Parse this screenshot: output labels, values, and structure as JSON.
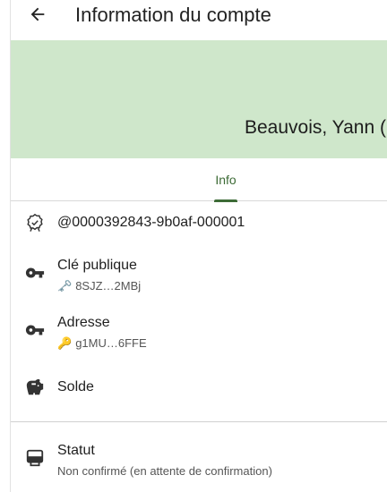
{
  "app_bar": {
    "title": "Information du compte"
  },
  "banner": {
    "name": "Beauvois, Yann ("
  },
  "tabs": [
    {
      "label": "Info"
    }
  ],
  "info": {
    "uid": "@0000392843-9b0af-000001",
    "public_key": {
      "label": "Clé publique",
      "emoji": "🗝️",
      "value": "8SJZ…2MBj"
    },
    "address": {
      "label": "Adresse",
      "emoji": "🔑",
      "value": "g1MU…6FFE"
    },
    "balance": {
      "label": "Solde"
    },
    "status": {
      "label": "Statut",
      "value": "Non confirmé (en attente de confirmation)"
    }
  },
  "colors": {
    "banner": "#cfe7cb",
    "accent": "#3d6b36"
  }
}
